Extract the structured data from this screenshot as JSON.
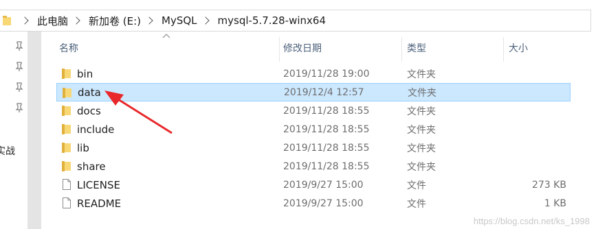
{
  "breadcrumbs": [
    "此电脑",
    "新加卷 (E:)",
    "MySQL",
    "mysql-5.7.28-winx64"
  ],
  "nav": {
    "partial_label": "实战"
  },
  "columns": {
    "name": "名称",
    "modified": "修改日期",
    "type": "类型",
    "size": "大小"
  },
  "files": [
    {
      "name": "bin",
      "modified": "2019/11/28 19:00",
      "type": "文件夹",
      "size": "",
      "icon": "folder-icon",
      "selected": false
    },
    {
      "name": "data",
      "modified": "2019/12/4 12:57",
      "type": "文件夹",
      "size": "",
      "icon": "folder-icon",
      "selected": true
    },
    {
      "name": "docs",
      "modified": "2019/11/28 18:55",
      "type": "文件夹",
      "size": "",
      "icon": "folder-icon",
      "selected": false
    },
    {
      "name": "include",
      "modified": "2019/11/28 18:55",
      "type": "文件夹",
      "size": "",
      "icon": "folder-icon",
      "selected": false
    },
    {
      "name": "lib",
      "modified": "2019/11/28 18:55",
      "type": "文件夹",
      "size": "",
      "icon": "folder-icon",
      "selected": false
    },
    {
      "name": "share",
      "modified": "2019/11/28 18:55",
      "type": "文件夹",
      "size": "",
      "icon": "folder-icon",
      "selected": false
    },
    {
      "name": "LICENSE",
      "modified": "2019/9/27 15:00",
      "type": "文件",
      "size": "273 KB",
      "icon": "file-icon",
      "selected": false
    },
    {
      "name": "README",
      "modified": "2019/9/27 15:00",
      "type": "文件",
      "size": "1 KB",
      "icon": "file-icon",
      "selected": false
    }
  ],
  "watermark": "https://blog.csdn.net/ks_1998",
  "colors": {
    "selection": "#cce8ff",
    "selection_border": "#99d1ff",
    "folder": "#f8d775",
    "annotation_arrow": "#e8282b"
  }
}
